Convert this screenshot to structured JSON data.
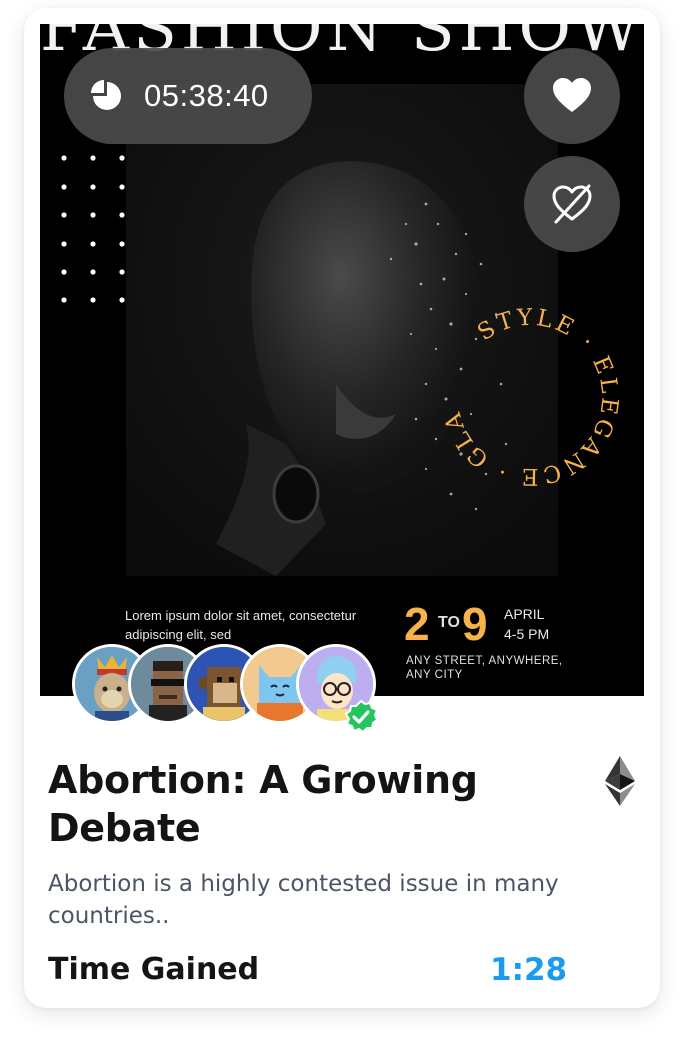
{
  "poster": {
    "show_title": "FASHION SHOW",
    "arc_text": "STYLE · ELEGANCE · GLAMOR ·",
    "promo_text": "Lorem ipsum dolor sit amet, consectetur adipiscing elit, sed",
    "date_start": "2",
    "date_to": "TO",
    "date_end": "9",
    "month": "APRIL",
    "time": "4-5 PM",
    "venue_line1": "ANY STREET, ANYWHERE,",
    "venue_line2": "ANY CITY",
    "accent_color": "#f7b24a"
  },
  "timer": {
    "icon": "pie-clock-icon",
    "value": "05:38:40"
  },
  "actions": {
    "like_icon": "heart-icon",
    "unlike_icon": "heart-crossed-icon"
  },
  "avatars": [
    {
      "name": "ape-king-avatar",
      "bg": "#5a8fb4"
    },
    {
      "name": "pixel-punk-avatar",
      "bg": "#6f8fa0"
    },
    {
      "name": "pixel-monkey-avatar",
      "bg": "#2a4fa8"
    },
    {
      "name": "blue-cat-avatar",
      "bg": "#f0c080"
    },
    {
      "name": "glasses-person-avatar",
      "bg": "#b9a8f0"
    }
  ],
  "verified_color": "#22c55e",
  "card": {
    "title": "Abortion: A Growing Debate",
    "description": "Abortion is a highly contested issue in many countries..",
    "currency_icon": "ethereum-icon",
    "time_gained_label": "Time Gained",
    "time_gained_value": "1:28",
    "value_color": "#1a9bf0"
  }
}
